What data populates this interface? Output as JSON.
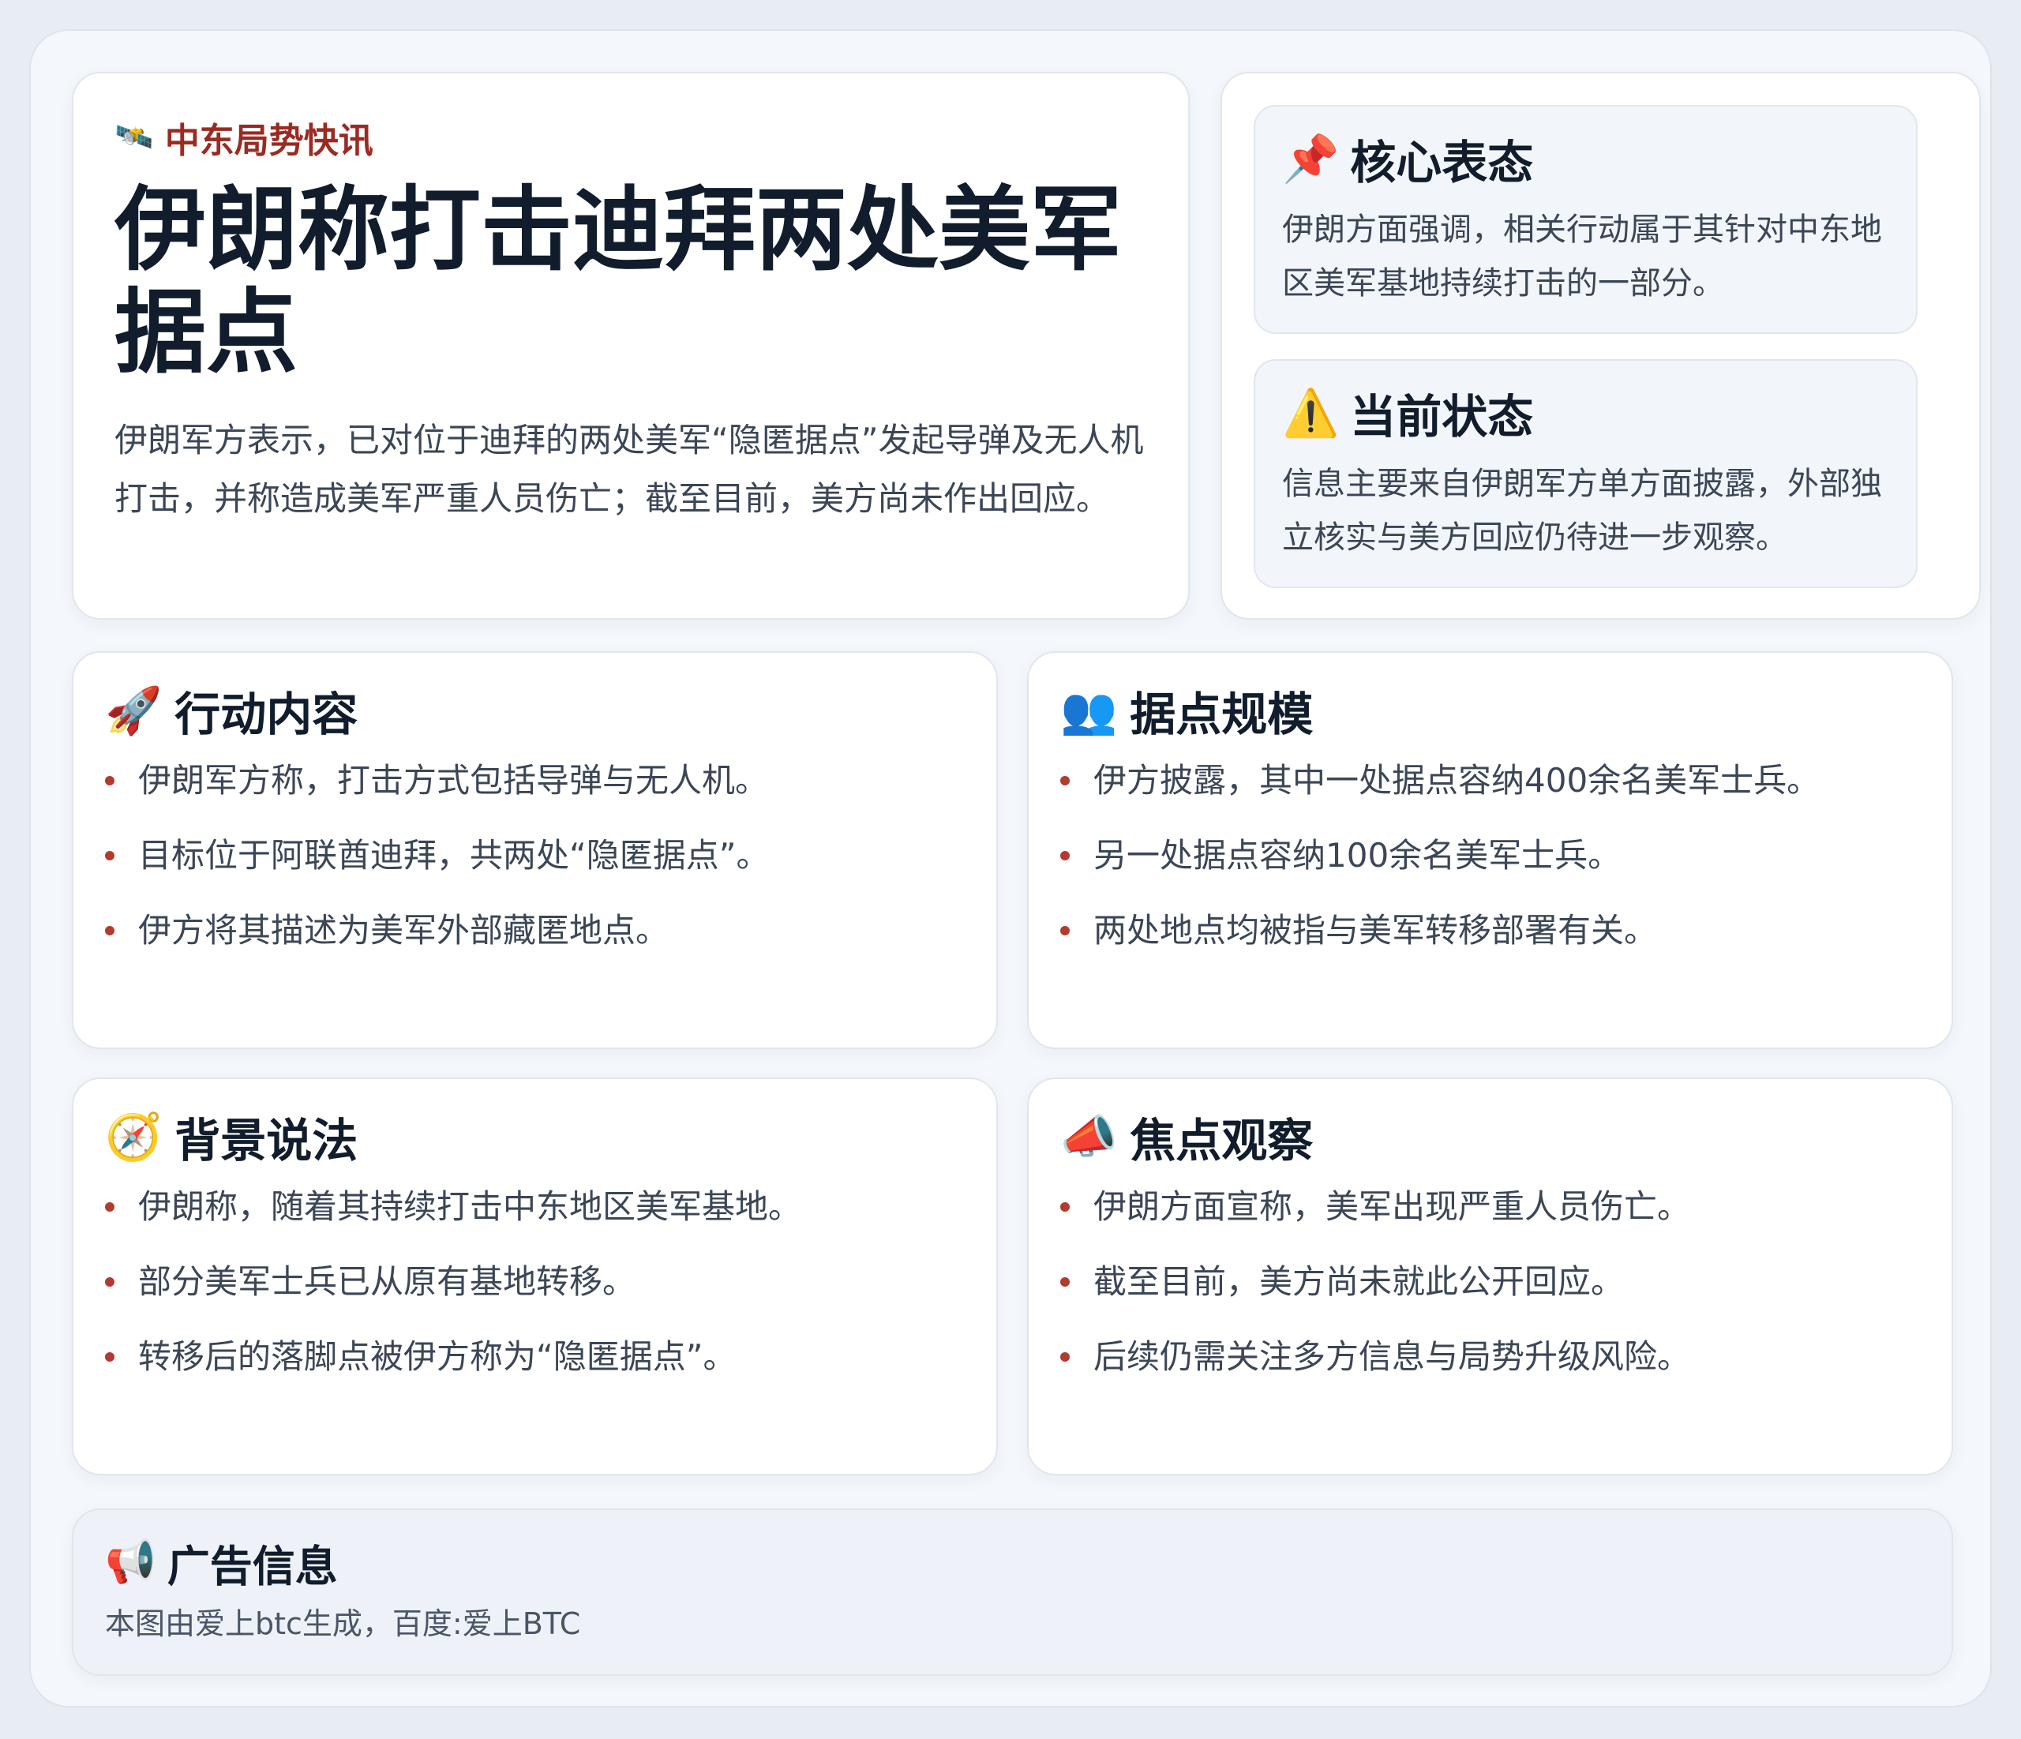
{
  "hero": {
    "kicker_icon": "🛰️",
    "kicker": "中东局势快讯",
    "title": "伊朗称打击迪拜两处美军据点",
    "summary": "伊朗军方表示，已对位于迪拜的两处美军“隐匿据点”发起导弹及无人机打击，并称造成美军严重人员伤亡；截至目前，美方尚未作出回应。"
  },
  "side": {
    "core": {
      "icon": "📌",
      "title": "核心表态",
      "body": "伊朗方面强调，相关行动属于其针对中东地区美军基地持续打击的一部分。"
    },
    "status": {
      "icon": "⚠️",
      "title": "当前状态",
      "body": "信息主要来自伊朗军方单方面披露，外部独立核实与美方回应仍待进一步观察。"
    }
  },
  "cards": [
    {
      "icon": "🚀",
      "title": "行动内容",
      "items": [
        "伊朗军方称，打击方式包括导弹与无人机。",
        "目标位于阿联酋迪拜，共两处“隐匿据点”。",
        "伊方将其描述为美军外部藏匿地点。"
      ]
    },
    {
      "icon": "👥",
      "title": "据点规模",
      "items": [
        "伊方披露，其中一处据点容纳400余名美军士兵。",
        "另一处据点容纳100余名美军士兵。",
        "两处地点均被指与美军转移部署有关。"
      ]
    },
    {
      "icon": "🧭",
      "title": "背景说法",
      "items": [
        "伊朗称，随着其持续打击中东地区美军基地。",
        "部分美军士兵已从原有基地转移。",
        "转移后的落脚点被伊方称为“隐匿据点”。"
      ]
    },
    {
      "icon": "📣",
      "title": "焦点观察",
      "items": [
        "伊朗方面宣称，美军出现严重人员伤亡。",
        "截至目前，美方尚未就此公开回应。",
        "后续仍需关注多方信息与局势升级风险。"
      ]
    }
  ],
  "ad": {
    "icon": "📢",
    "title": "广告信息",
    "body": "本图由爱上btc生成，百度:爱上BTC"
  },
  "colors": {
    "accent": "#9a2b22",
    "bullet": "#b23b2f",
    "heading": "#111d2c",
    "body_text": "#3b4656",
    "background": "#e8edf4"
  }
}
